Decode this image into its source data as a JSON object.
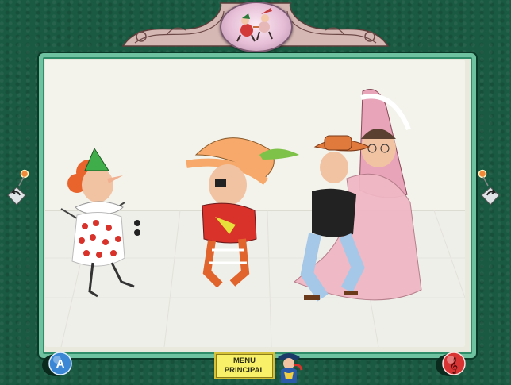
{
  "window": {
    "title": ""
  },
  "menu_button": {
    "label": "MENU\nPRINCIPAL"
  },
  "bottom_left_button": {
    "letter": "A"
  },
  "bottom_right_button": {
    "glyph": "𝄞"
  },
  "icons": {
    "left_nav": "back-arrow-icon",
    "right_nav": "forward-arrow-icon",
    "mascot": "pirate-parrot-mascot-icon",
    "medallion": "dancing-characters-medallion-icon"
  },
  "colors": {
    "background": "#1a5a42",
    "frame_border": "#6fc2a0",
    "menu_button": "#f7f068",
    "a_button": "#3b87d6",
    "music_button": "#d93434"
  }
}
